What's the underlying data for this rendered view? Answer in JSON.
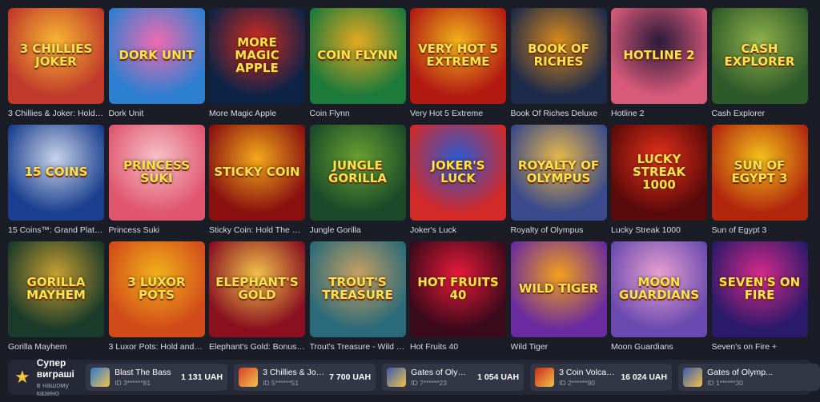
{
  "games": [
    {
      "name": "3 Chillies & Joker: Hold a...",
      "art": "3 Chillies Joker",
      "bg": "#c0392b",
      "bg2": "#f7b733"
    },
    {
      "name": "Dork Unit",
      "art": "Dork Unit",
      "bg": "#2d7fd1",
      "bg2": "#f06ab0"
    },
    {
      "name": "More Magic Apple",
      "art": "More Magic Apple",
      "bg": "#0c2346",
      "bg2": "#d42a20"
    },
    {
      "name": "Coin Flynn",
      "art": "Coin Flynn",
      "bg": "#1c7a3a",
      "bg2": "#e6a820"
    },
    {
      "name": "Very Hot 5 Extreme",
      "art": "Very Hot 5 Extreme",
      "bg": "#b21a12",
      "bg2": "#f2b21a"
    },
    {
      "name": "Book Of Riches Deluxe",
      "art": "Book of Riches",
      "bg": "#1e2a4a",
      "bg2": "#d98b1a"
    },
    {
      "name": "Hotline 2",
      "art": "Hotline 2",
      "bg": "#d85a7a",
      "bg2": "#2a1a3a"
    },
    {
      "name": "Cash Explorer",
      "art": "Cash Explorer",
      "bg": "#2e5a2a",
      "bg2": "#8fb04a"
    },
    {
      "name": "15 Coins™: Grand Platinu...",
      "art": "15 Coins",
      "bg": "#1a3f8f",
      "bg2": "#c8d2e8"
    },
    {
      "name": "Princess Suki",
      "art": "Princess Suki",
      "bg": "#e0566e",
      "bg2": "#f6c2c8"
    },
    {
      "name": "Sticky Coin: Hold The Spin",
      "art": "Sticky Coin",
      "bg": "#8a1010",
      "bg2": "#f2a81a"
    },
    {
      "name": "Jungle Gorilla",
      "art": "Jungle Gorilla",
      "bg": "#1a4a2a",
      "bg2": "#6aa030"
    },
    {
      "name": "Joker's Luck",
      "art": "Joker's Luck",
      "bg": "#d32a2a",
      "bg2": "#2a5ad3"
    },
    {
      "name": "Royalty of Olympus",
      "art": "Royalty of Olympus",
      "bg": "#3a4a8a",
      "bg2": "#e8b84a"
    },
    {
      "name": "Lucky Streak 1000",
      "art": "Lucky Streak 1000",
      "bg": "#5a0a0a",
      "bg2": "#e8301a"
    },
    {
      "name": "Sun of Egypt 3",
      "art": "Sun of Egypt 3",
      "bg": "#b2260e",
      "bg2": "#f2c21a"
    },
    {
      "name": "Gorilla Mayhem",
      "art": "Gorilla Mayhem",
      "bg": "#1a3a2a",
      "bg2": "#c8a030"
    },
    {
      "name": "3 Luxor Pots: Hold and Win",
      "art": "3 Luxor Pots",
      "bg": "#d24a1a",
      "bg2": "#f2b21a"
    },
    {
      "name": "Elephant's Gold: Bonus C...",
      "art": "Elephant's Gold",
      "bg": "#8a1020",
      "bg2": "#f2c24a"
    },
    {
      "name": "Trout's Treasure - Wild Ri...",
      "art": "Trout's Treasure",
      "bg": "#2a6a7a",
      "bg2": "#c8a060"
    },
    {
      "name": "Hot Fruits 40",
      "art": "Hot Fruits 40",
      "bg": "#3a0a1a",
      "bg2": "#e81a3a"
    },
    {
      "name": "Wild Tiger",
      "art": "Wild Tiger",
      "bg": "#6a2aa0",
      "bg2": "#f2a01a"
    },
    {
      "name": "Moon Guardians",
      "art": "Moon Guardians",
      "bg": "#6a4ab0",
      "bg2": "#e8a0d0"
    },
    {
      "name": "Seven's on Fire +",
      "art": "Seven's on Fire",
      "bg": "#2a1a6a",
      "bg2": "#d82a8a"
    }
  ],
  "promo": {
    "title": "Супер виграші",
    "subtitle": "в нашому казино"
  },
  "wins": [
    {
      "game": "Blast The Bass",
      "id": "ID 3******81",
      "amount": "1 131 UAH",
      "color": "#2a7ad3"
    },
    {
      "game": "3 Chillies & Jok...",
      "id": "ID 5******51",
      "amount": "7 700 UAH",
      "color": "#d3402a"
    },
    {
      "game": "Gates of Olymp...",
      "id": "ID 7******23",
      "amount": "1 054 UAH",
      "color": "#3a5ab0"
    },
    {
      "game": "3 Coin Volcan...",
      "id": "ID 2******90",
      "amount": "16 024 UAH",
      "color": "#c82a1a"
    },
    {
      "game": "Gates of Olymp...",
      "id": "ID 1******30",
      "amount": "",
      "color": "#3a5ab0"
    }
  ]
}
